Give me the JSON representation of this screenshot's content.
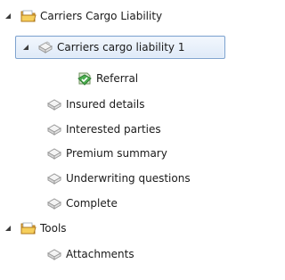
{
  "tree": {
    "items": [
      {
        "label": "Carriers Cargo Liability",
        "icon": "folder-icon",
        "expanded": true
      },
      {
        "label": "Carriers cargo liability 1",
        "icon": "form-page-icon",
        "expanded": true,
        "selected": true
      },
      {
        "label": "Referral",
        "icon": "referral-shield-icon"
      },
      {
        "label": "Insured details",
        "icon": "form-page-icon"
      },
      {
        "label": "Interested parties",
        "icon": "form-page-icon"
      },
      {
        "label": "Premium summary",
        "icon": "form-page-icon"
      },
      {
        "label": "Underwriting questions",
        "icon": "form-page-icon"
      },
      {
        "label": "Complete",
        "icon": "form-page-icon"
      },
      {
        "label": "Tools",
        "icon": "folder-icon",
        "expanded": true
      },
      {
        "label": "Attachments",
        "icon": "form-page-icon"
      }
    ]
  },
  "colors": {
    "selection_border": "#7da2ce",
    "selection_fill": "#dfeaf8",
    "folder": "#f2c14e",
    "referral_green": "#4caf50"
  }
}
